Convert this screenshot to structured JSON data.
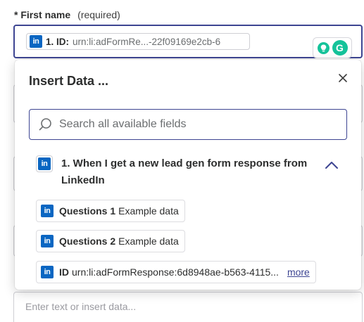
{
  "field": {
    "required_marker": "*",
    "label": "First name",
    "required_text": "(required)",
    "pill": {
      "label": "1. ID:",
      "value": "urn:li:adFormRe...-22f09169e2cb-6"
    }
  },
  "background_field_placeholder": "Enter text or insert data...",
  "popover": {
    "title": "Insert Data ...",
    "search_placeholder": "Search all available fields",
    "step": {
      "title": "1. When I get a new lead gen form response from LinkedIn"
    },
    "items": [
      {
        "key": "Questions 1",
        "value": "Example data"
      },
      {
        "key": "Questions 2",
        "value": "Example data"
      },
      {
        "key": "ID",
        "value": "urn:li:adFormResponse:6d8948ae-b563-4115...",
        "more": "more"
      }
    ]
  },
  "icons": {
    "app": "linkedin-icon",
    "close": "close-icon",
    "search": "search-icon",
    "collapse": "chevron-up-icon",
    "extension": "grammarly-icon"
  },
  "colors": {
    "accent": "#3d4592",
    "linkedin": "#0a66c2",
    "grammarly": "#15c39a"
  }
}
